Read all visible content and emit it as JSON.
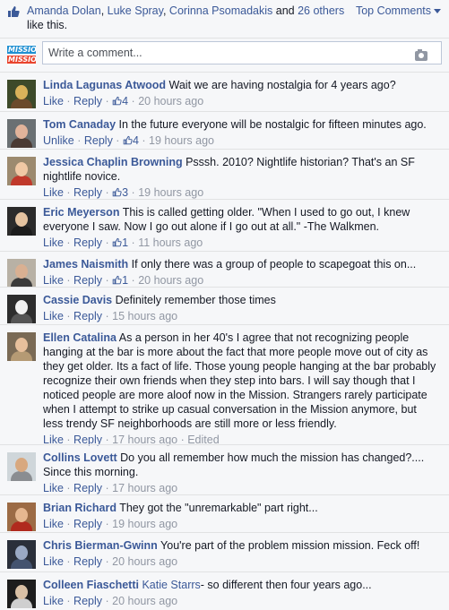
{
  "likes": {
    "names": [
      "Amanda Dolan",
      "Luke Spray",
      "Corinna Psomadakis"
    ],
    "and_text": "and",
    "others": "26 others",
    "suffix": "like this."
  },
  "sort": {
    "label": "Top Comments"
  },
  "composer": {
    "placeholder": "Write a comment...",
    "avatar_lines": [
      "MISSION",
      "MISSION"
    ]
  },
  "comments": [
    {
      "name": "Linda Lagunas Atwood",
      "text": "Wait we are having nostalgia for 4 years ago?",
      "action": "Like",
      "reply": "Reply",
      "likes": "4",
      "time": "20 hours ago"
    },
    {
      "name": "Tom Canaday",
      "text": "In the future everyone will be nostalgic for fifteen minutes ago.",
      "action": "Unlike",
      "reply": "Reply",
      "likes": "4",
      "time": "19 hours ago"
    },
    {
      "name": "Jessica Chaplin Browning",
      "text": "Psssh. 2010? Nightlife historian? That's an SF nightlife novice.",
      "action": "Like",
      "reply": "Reply",
      "likes": "3",
      "time": "19 hours ago"
    },
    {
      "name": "Eric Meyerson",
      "text": "This is called getting older. \"When I used to go out, I knew everyone I saw. Now I go out alone if I go out at all.\" -The Walkmen.",
      "action": "Like",
      "reply": "Reply",
      "likes": "1",
      "time": "11 hours ago"
    },
    {
      "name": "James Naismith",
      "text": "If only there was a group of people to scapegoat this on...",
      "action": "Like",
      "reply": "Reply",
      "likes": "1",
      "time": "20 hours ago"
    },
    {
      "name": "Cassie Davis",
      "text": "Definitely remember those times",
      "action": "Like",
      "reply": "Reply",
      "time": "15 hours ago"
    },
    {
      "name": "Ellen Catalina",
      "text": "As a person in her 40's I agree that not recognizing people hanging at the bar is more about the fact that more people move out of city as they get older. Its a fact of life. Those young people hanging at the bar probably recognize their own friends when they step into bars. I will say though that I noticed people are more aloof now in the Mission. Strangers rarely participate when I attempt to strike up casual conversation in the Mission anymore, but less trendy SF neighborhoods are still more or less friendly.",
      "action": "Like",
      "reply": "Reply",
      "time": "17 hours ago",
      "edited": "Edited"
    },
    {
      "name": "Collins Lovett",
      "text": "Do you all remember how much the mission has changed?.... Since this morning.",
      "action": "Like",
      "reply": "Reply",
      "time": "17 hours ago"
    },
    {
      "name": "Brian Richard",
      "text": "They got the \"unremarkable\" part right...",
      "action": "Like",
      "reply": "Reply",
      "time": "19 hours ago"
    },
    {
      "name": "Chris Bierman-Gwinn",
      "text": "You're part of the problem mission mission. Feck off!",
      "action": "Like",
      "reply": "Reply",
      "time": "20 hours ago"
    },
    {
      "name": "Colleen Fiaschetti",
      "tag": "Katie Starrs",
      "text": "- so different then four years ago...",
      "action": "Like",
      "reply": "Reply",
      "time": "20 hours ago"
    }
  ]
}
